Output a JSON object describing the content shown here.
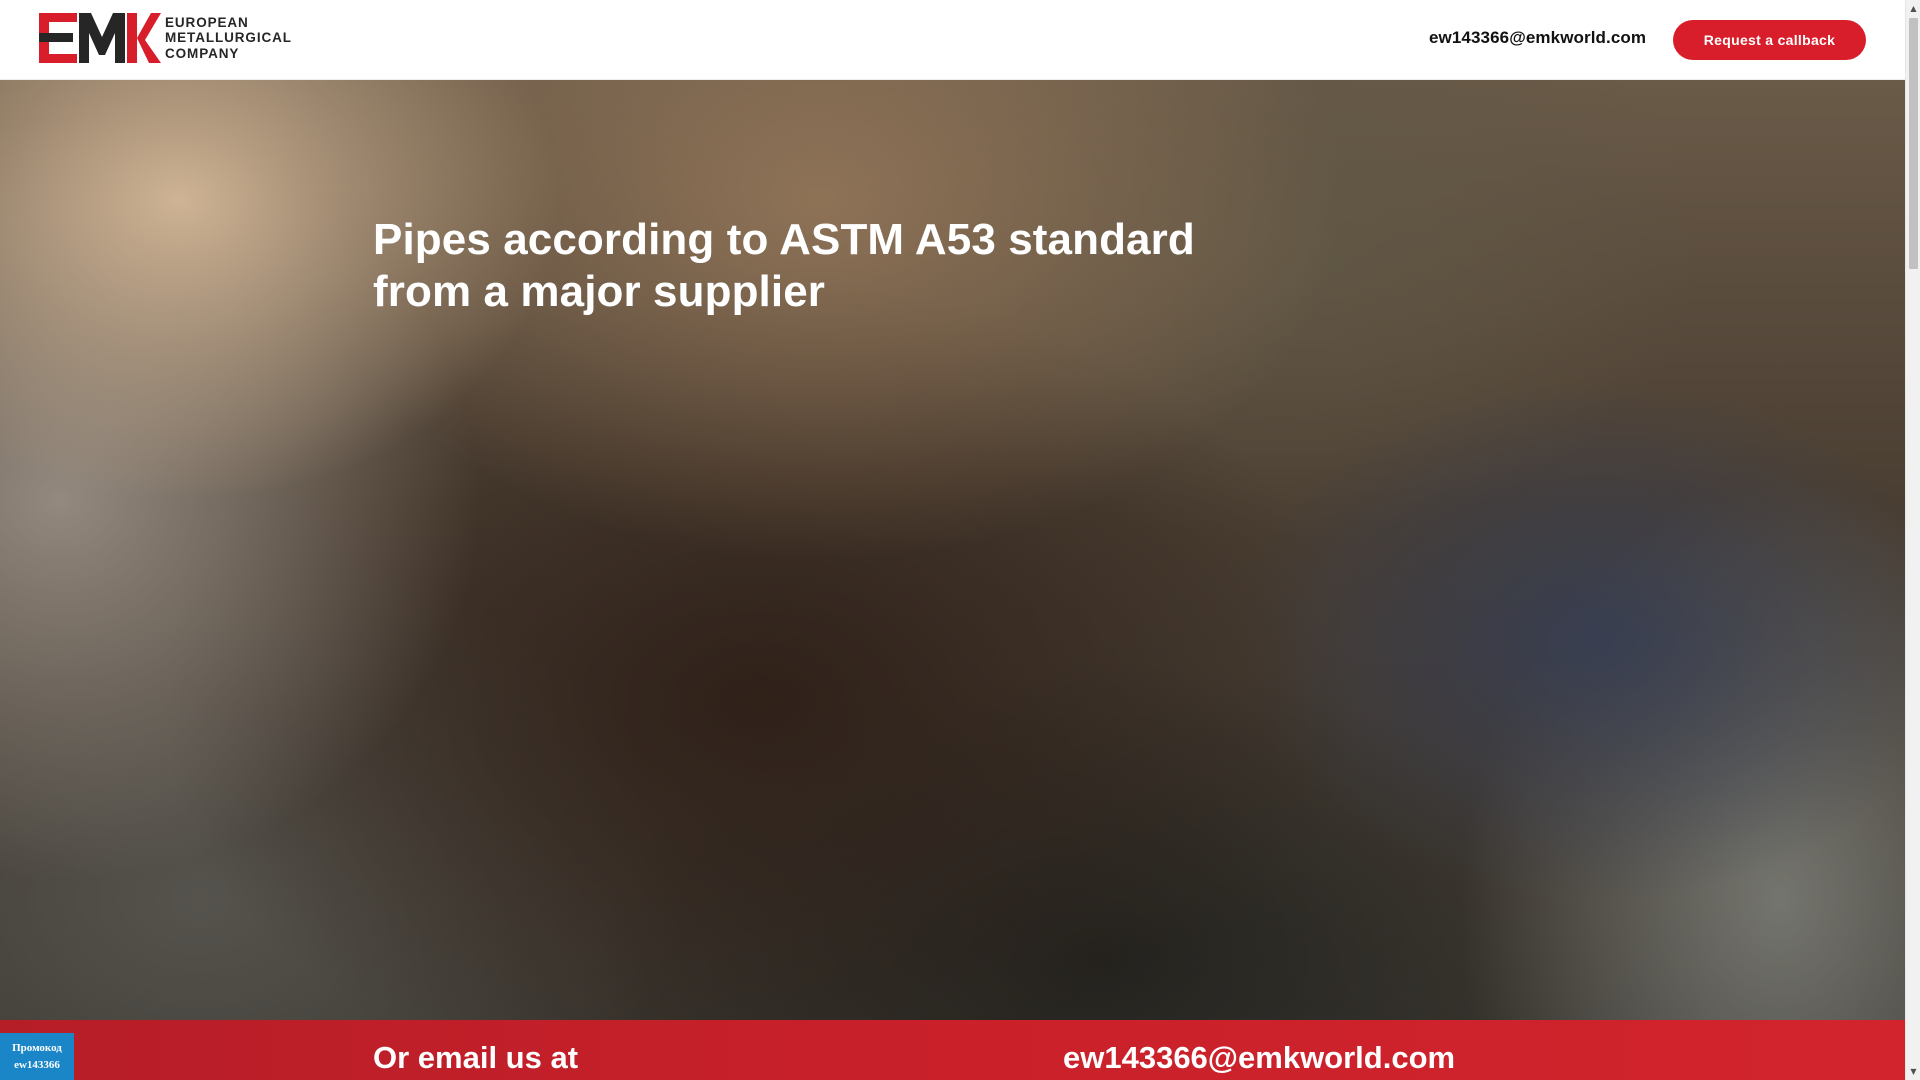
{
  "logo": {
    "mark_letters": "EMK",
    "line1": "EUROPEAN",
    "line2": "METALLURGICAL",
    "line3": "COMPANY",
    "colors": {
      "red": "#d81e2a",
      "dark": "#262626"
    }
  },
  "header": {
    "email": "ew143366@emkworld.com",
    "callback_label": "Request a callback"
  },
  "hero": {
    "title_line1": "Pipes according to ASTM A53 standard",
    "title_line2": "from a major supplier"
  },
  "email_band": {
    "label": "Or email us at",
    "email": "ew143366@emkworld.com"
  },
  "promo": {
    "label": "Промокод",
    "code": "ew143366"
  },
  "scrollbar": {
    "up_icon": "triangle-up",
    "down_icon": "triangle-down"
  },
  "colors": {
    "accent": "#d81e2a",
    "promo_bg": "#1a86c8"
  }
}
